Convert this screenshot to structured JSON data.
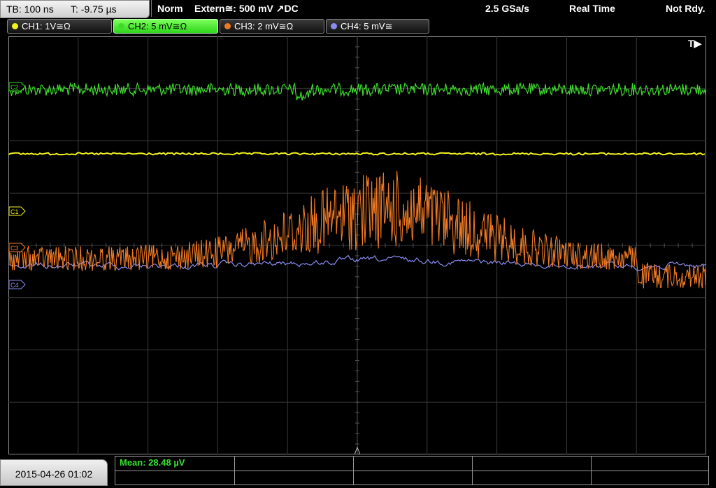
{
  "topbar": {
    "timebase": "TB: 100 ns",
    "trigger_time": "T: -9.75 µs",
    "mode": "Norm",
    "trigger_source": "Extern≅: 500 mV ↗DC",
    "sample_rate": "2.5 GSa/s",
    "acq_mode": "Real Time",
    "status": "Not Rdy."
  },
  "channels": [
    {
      "label": "CH1: 1V≅Ω",
      "color": "#f2f21e",
      "active": false
    },
    {
      "label": "CH2: 5 mV≅Ω",
      "color": "#3ddc2c",
      "active": true
    },
    {
      "label": "CH3: 2 mV≅Ω",
      "color": "#f07a24",
      "active": false
    },
    {
      "label": "CH4: 5 mV≅",
      "color": "#8a8cf0",
      "active": false
    }
  ],
  "scope": {
    "trigger_marker": "T▶",
    "markers": {
      "c2": "C2",
      "c1": "C1",
      "c3": "C3",
      "c4": "C4"
    }
  },
  "bottom": {
    "datetime": "2015-04-26 01:02",
    "measurement": "Mean: 28.48 µV"
  }
}
